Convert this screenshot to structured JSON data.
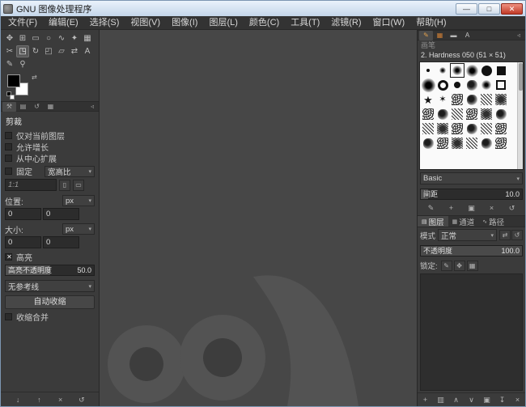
{
  "window": {
    "title": "GNU 图像处理程序",
    "minimize": "—",
    "maximize": "□",
    "close": "✕"
  },
  "menubar": {
    "items": [
      "文件(F)",
      "编辑(E)",
      "选择(S)",
      "视图(V)",
      "图像(I)",
      "图层(L)",
      "颜色(C)",
      "工具(T)",
      "滤镜(R)",
      "窗口(W)",
      "帮助(H)"
    ]
  },
  "toolbox": {
    "tools": [
      {
        "id": "move",
        "glyph": "✥",
        "selected": false
      },
      {
        "id": "alignment",
        "glyph": "⊞",
        "selected": false
      },
      {
        "id": "rectangle-select",
        "glyph": "▭",
        "selected": false
      },
      {
        "id": "ellipse-select",
        "glyph": "○",
        "selected": false
      },
      {
        "id": "free-select",
        "glyph": "∿",
        "selected": false
      },
      {
        "id": "fuzzy-select",
        "glyph": "✦",
        "selected": false
      },
      {
        "id": "select-by-color",
        "glyph": "▦",
        "selected": false
      },
      {
        "id": "scissors-select",
        "glyph": "✂",
        "selected": false
      },
      {
        "id": "crop",
        "glyph": "◳",
        "selected": true
      },
      {
        "id": "rotate",
        "glyph": "↻",
        "selected": false
      },
      {
        "id": "scale",
        "glyph": "◰",
        "selected": false
      },
      {
        "id": "perspective",
        "glyph": "▱",
        "selected": false
      },
      {
        "id": "flip",
        "glyph": "⇄",
        "selected": false
      },
      {
        "id": "text",
        "glyph": "A",
        "selected": false
      },
      {
        "id": "pencil",
        "glyph": "✎",
        "selected": false
      },
      {
        "id": "zoom",
        "glyph": "⚲",
        "selected": false
      }
    ],
    "foreground_color": "#000000",
    "background_color": "#ffffff",
    "bottom_icons": [
      {
        "id": "save-tool-options",
        "glyph": "↓"
      },
      {
        "id": "restore-tool-options",
        "glyph": "↑"
      },
      {
        "id": "delete-tool-options",
        "glyph": "×"
      },
      {
        "id": "reset-tool-options",
        "glyph": "↺"
      }
    ]
  },
  "tool_options": {
    "dock_tabs": [
      {
        "id": "tool-options",
        "glyph": "⚒",
        "selected": true
      },
      {
        "id": "device-status",
        "glyph": "▤",
        "selected": false
      },
      {
        "id": "undo-history",
        "glyph": "↺",
        "selected": false
      },
      {
        "id": "error-console",
        "glyph": "▦",
        "selected": false
      }
    ],
    "dock_menu_glyph": "◃",
    "title": "剪裁",
    "opt_current_layer": "仅对当前图层",
    "opt_allow_growing": "允许增长",
    "opt_expand_center": "从中心扩展",
    "opt_fixed": "固定",
    "fixed_mode": "宽高比",
    "aspect_value": "1:1",
    "aspect_buttons": [
      {
        "id": "portrait",
        "glyph": "▯"
      },
      {
        "id": "landscape",
        "glyph": "▭"
      }
    ],
    "position_label": "位置:",
    "position_x": "0",
    "position_y": "0",
    "position_unit": "px",
    "size_label": "大小:",
    "size_x": "0",
    "size_y": "0",
    "size_unit": "px",
    "opt_highlight": "高亮",
    "highlight_opacity_label": "高亮不透明度",
    "highlight_opacity_value": "50.0",
    "guides_value": "无参考线",
    "autoshrink_label": "自动收缩",
    "opt_shrink_merged": "收缩合并"
  },
  "brushes_panel": {
    "dock_tabs": [
      {
        "id": "brushes",
        "glyph": "✎",
        "selected": true,
        "tint": "#e3a14d"
      },
      {
        "id": "patterns",
        "glyph": "▦",
        "selected": false,
        "tint": "#cf7f35"
      },
      {
        "id": "gradients",
        "glyph": "▬",
        "selected": false,
        "tint": "#b9b9b9"
      },
      {
        "id": "fonts",
        "glyph": "A",
        "selected": false,
        "tint": "#c5c5c5"
      }
    ],
    "dock_menu_glyph": "◃",
    "dock_label": "画笔",
    "selected_brush": "2. Hardness 050 (51 × 51)",
    "selected_index": 2,
    "thumbnails": [
      "dot-s",
      "soft-s",
      "soft-m",
      "soft-l",
      "dot-l",
      "block",
      "soft-xl",
      "ring",
      "dot-m",
      "blob",
      "soft-m",
      "square",
      "star",
      "star2",
      "tex1",
      "blob",
      "tex2",
      "tex3",
      "tex1",
      "blob",
      "tex2",
      "tex1",
      "tex3",
      "blob",
      "tex2",
      "tex3",
      "tex1",
      "blob",
      "tex2",
      "tex1",
      "blob",
      "tex1",
      "tex3",
      "tex2",
      "blob",
      "tex1"
    ],
    "tag_filter": "Basic",
    "spacing_label": "间距",
    "spacing_value": "10.0",
    "actions": [
      {
        "id": "edit-brush",
        "glyph": "✎"
      },
      {
        "id": "new-brush",
        "glyph": "+"
      },
      {
        "id": "duplicate-brush",
        "glyph": "▣"
      },
      {
        "id": "delete-brush",
        "glyph": "×"
      },
      {
        "id": "refresh-brushes",
        "glyph": "↺"
      }
    ]
  },
  "layers_panel": {
    "tabs": [
      {
        "id": "layers",
        "glyph": "▤",
        "label": "图层",
        "selected": true
      },
      {
        "id": "channels",
        "glyph": "▦",
        "label": "通道",
        "selected": false
      },
      {
        "id": "paths",
        "glyph": "∿",
        "label": "路径",
        "selected": false
      }
    ],
    "mode_label": "模式",
    "mode_value": "正常",
    "mode_buttons": [
      {
        "id": "mode-group-toggle",
        "glyph": "⇄"
      },
      {
        "id": "mode-default",
        "glyph": "↺"
      }
    ],
    "opacity_label": "不透明度",
    "opacity_value": "100.0",
    "lock_label": "锁定:",
    "lock_buttons": [
      {
        "id": "lock-pixels",
        "glyph": "✎"
      },
      {
        "id": "lock-position",
        "glyph": "✥"
      },
      {
        "id": "lock-alpha",
        "glyph": "▦"
      }
    ],
    "bottom_icons": [
      {
        "id": "new-layer",
        "glyph": "+"
      },
      {
        "id": "new-layer-group",
        "glyph": "▥"
      },
      {
        "id": "raise-layer",
        "glyph": "∧"
      },
      {
        "id": "lower-layer",
        "glyph": "∨"
      },
      {
        "id": "duplicate-layer",
        "glyph": "▣"
      },
      {
        "id": "anchor-layer",
        "glyph": "↧"
      },
      {
        "id": "delete-layer",
        "glyph": "×"
      }
    ]
  }
}
